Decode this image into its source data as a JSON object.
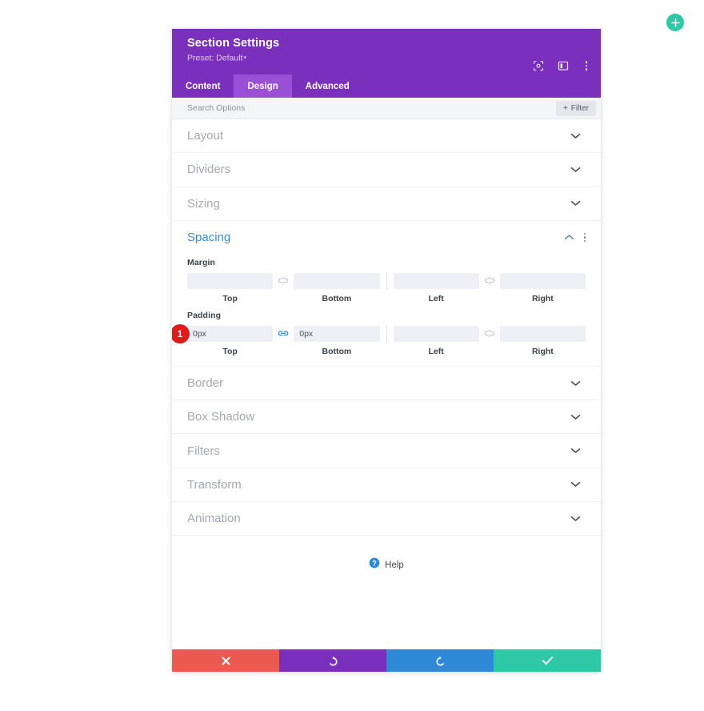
{
  "fab": {
    "name": "add-button",
    "glyph": "+",
    "color": "#2ec8a6"
  },
  "panel": {
    "title": "Section Settings",
    "preset": "Preset: Default",
    "preset_caret": "▾",
    "header_color": "#7a2fbd",
    "icons": [
      {
        "name": "focus-target-icon"
      },
      {
        "name": "layout-panel-icon"
      },
      {
        "name": "more-options-icon"
      }
    ],
    "tabs": [
      {
        "label": "Content",
        "active": false
      },
      {
        "label": "Design",
        "active": true
      },
      {
        "label": "Advanced",
        "active": false
      }
    ],
    "search": {
      "placeholder": "Search Options",
      "value": ""
    },
    "filter_button": {
      "label": "Filter",
      "plus": "+"
    }
  },
  "sections_top": [
    {
      "label": "Layout"
    },
    {
      "label": "Dividers"
    },
    {
      "label": "Sizing"
    }
  ],
  "spacing": {
    "title": "Spacing",
    "accent_color": "#3b8bd0",
    "groups": [
      {
        "label": "Margin",
        "badge": null,
        "linked": false,
        "link_icon": "unlinked-chain-icon",
        "fields": [
          {
            "sub": "Top",
            "value": "",
            "placeholder": ""
          },
          {
            "sub": "Bottom",
            "value": "",
            "placeholder": ""
          },
          {
            "sub": "Left",
            "value": "",
            "placeholder": ""
          },
          {
            "sub": "Right",
            "value": "",
            "placeholder": ""
          }
        ],
        "right_link_icon": "unlinked-chain-icon",
        "right_linked": false
      },
      {
        "label": "Padding",
        "badge": "1",
        "badge_color": "#e01b1b",
        "linked": true,
        "link_icon": "linked-chain-icon",
        "fields": [
          {
            "sub": "Top",
            "value": "0px",
            "placeholder": ""
          },
          {
            "sub": "Bottom",
            "value": "0px",
            "placeholder": ""
          },
          {
            "sub": "Left",
            "value": "",
            "placeholder": ""
          },
          {
            "sub": "Right",
            "value": "",
            "placeholder": ""
          }
        ],
        "right_link_icon": "unlinked-chain-icon",
        "right_linked": false
      }
    ]
  },
  "sections_bottom": [
    {
      "label": "Border"
    },
    {
      "label": "Box Shadow"
    },
    {
      "label": "Filters"
    },
    {
      "label": "Transform"
    },
    {
      "label": "Animation"
    }
  ],
  "help": {
    "label": "Help",
    "icon": "question-mark-icon"
  },
  "footer": [
    {
      "name": "cancel-button",
      "icon": "close-x-icon",
      "color": "#ea5a51"
    },
    {
      "name": "undo-button",
      "icon": "undo-arrow-icon",
      "color": "#7a2fbd"
    },
    {
      "name": "redo-button",
      "icon": "redo-arrow-icon",
      "color": "#2e89d6"
    },
    {
      "name": "save-button",
      "icon": "checkmark-icon",
      "color": "#2ec8a6"
    }
  ]
}
